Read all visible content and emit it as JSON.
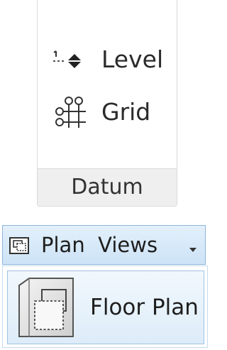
{
  "datum_panel": {
    "title": "Datum",
    "tools": [
      {
        "label": "Level",
        "icon": "level-icon"
      },
      {
        "label": "Grid",
        "icon": "grid-icon"
      }
    ]
  },
  "plan_views": {
    "button_label": "Plan  Views",
    "icon": "plan-views-icon",
    "caret_icon": "chevron-down-icon",
    "menu_items": [
      {
        "label": "Floor Plan",
        "icon": "floor-plan-icon"
      }
    ]
  },
  "colors": {
    "highlight_bg": "#cde3f6",
    "highlight_border": "#8cb5da",
    "panel_title_bg": "#efefef"
  }
}
